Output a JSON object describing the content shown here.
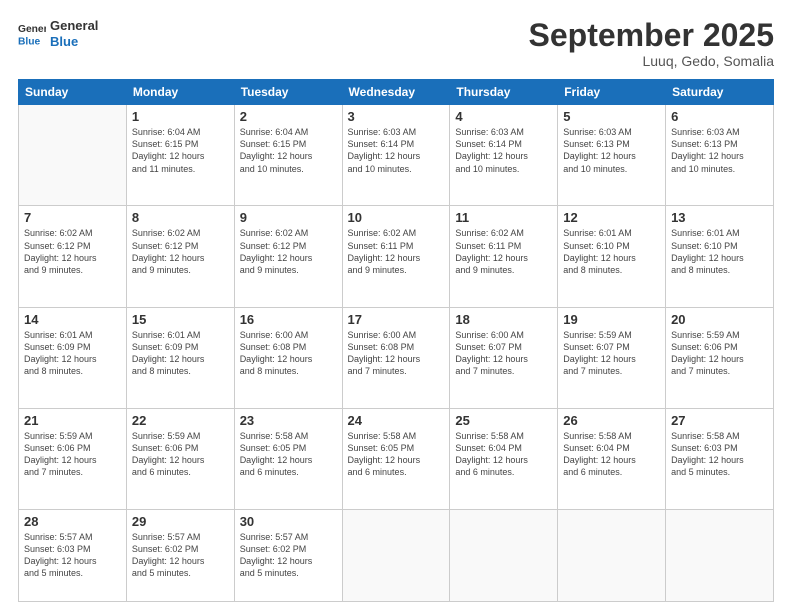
{
  "header": {
    "logo_line1": "General",
    "logo_line2": "Blue",
    "month": "September 2025",
    "location": "Luuq, Gedo, Somalia"
  },
  "weekdays": [
    "Sunday",
    "Monday",
    "Tuesday",
    "Wednesday",
    "Thursday",
    "Friday",
    "Saturday"
  ],
  "weeks": [
    [
      {
        "day": "",
        "info": ""
      },
      {
        "day": "1",
        "info": "Sunrise: 6:04 AM\nSunset: 6:15 PM\nDaylight: 12 hours\nand 11 minutes."
      },
      {
        "day": "2",
        "info": "Sunrise: 6:04 AM\nSunset: 6:15 PM\nDaylight: 12 hours\nand 10 minutes."
      },
      {
        "day": "3",
        "info": "Sunrise: 6:03 AM\nSunset: 6:14 PM\nDaylight: 12 hours\nand 10 minutes."
      },
      {
        "day": "4",
        "info": "Sunrise: 6:03 AM\nSunset: 6:14 PM\nDaylight: 12 hours\nand 10 minutes."
      },
      {
        "day": "5",
        "info": "Sunrise: 6:03 AM\nSunset: 6:13 PM\nDaylight: 12 hours\nand 10 minutes."
      },
      {
        "day": "6",
        "info": "Sunrise: 6:03 AM\nSunset: 6:13 PM\nDaylight: 12 hours\nand 10 minutes."
      }
    ],
    [
      {
        "day": "7",
        "info": "Sunrise: 6:02 AM\nSunset: 6:12 PM\nDaylight: 12 hours\nand 9 minutes."
      },
      {
        "day": "8",
        "info": "Sunrise: 6:02 AM\nSunset: 6:12 PM\nDaylight: 12 hours\nand 9 minutes."
      },
      {
        "day": "9",
        "info": "Sunrise: 6:02 AM\nSunset: 6:12 PM\nDaylight: 12 hours\nand 9 minutes."
      },
      {
        "day": "10",
        "info": "Sunrise: 6:02 AM\nSunset: 6:11 PM\nDaylight: 12 hours\nand 9 minutes."
      },
      {
        "day": "11",
        "info": "Sunrise: 6:02 AM\nSunset: 6:11 PM\nDaylight: 12 hours\nand 9 minutes."
      },
      {
        "day": "12",
        "info": "Sunrise: 6:01 AM\nSunset: 6:10 PM\nDaylight: 12 hours\nand 8 minutes."
      },
      {
        "day": "13",
        "info": "Sunrise: 6:01 AM\nSunset: 6:10 PM\nDaylight: 12 hours\nand 8 minutes."
      }
    ],
    [
      {
        "day": "14",
        "info": "Sunrise: 6:01 AM\nSunset: 6:09 PM\nDaylight: 12 hours\nand 8 minutes."
      },
      {
        "day": "15",
        "info": "Sunrise: 6:01 AM\nSunset: 6:09 PM\nDaylight: 12 hours\nand 8 minutes."
      },
      {
        "day": "16",
        "info": "Sunrise: 6:00 AM\nSunset: 6:08 PM\nDaylight: 12 hours\nand 8 minutes."
      },
      {
        "day": "17",
        "info": "Sunrise: 6:00 AM\nSunset: 6:08 PM\nDaylight: 12 hours\nand 7 minutes."
      },
      {
        "day": "18",
        "info": "Sunrise: 6:00 AM\nSunset: 6:07 PM\nDaylight: 12 hours\nand 7 minutes."
      },
      {
        "day": "19",
        "info": "Sunrise: 5:59 AM\nSunset: 6:07 PM\nDaylight: 12 hours\nand 7 minutes."
      },
      {
        "day": "20",
        "info": "Sunrise: 5:59 AM\nSunset: 6:06 PM\nDaylight: 12 hours\nand 7 minutes."
      }
    ],
    [
      {
        "day": "21",
        "info": "Sunrise: 5:59 AM\nSunset: 6:06 PM\nDaylight: 12 hours\nand 7 minutes."
      },
      {
        "day": "22",
        "info": "Sunrise: 5:59 AM\nSunset: 6:06 PM\nDaylight: 12 hours\nand 6 minutes."
      },
      {
        "day": "23",
        "info": "Sunrise: 5:58 AM\nSunset: 6:05 PM\nDaylight: 12 hours\nand 6 minutes."
      },
      {
        "day": "24",
        "info": "Sunrise: 5:58 AM\nSunset: 6:05 PM\nDaylight: 12 hours\nand 6 minutes."
      },
      {
        "day": "25",
        "info": "Sunrise: 5:58 AM\nSunset: 6:04 PM\nDaylight: 12 hours\nand 6 minutes."
      },
      {
        "day": "26",
        "info": "Sunrise: 5:58 AM\nSunset: 6:04 PM\nDaylight: 12 hours\nand 6 minutes."
      },
      {
        "day": "27",
        "info": "Sunrise: 5:58 AM\nSunset: 6:03 PM\nDaylight: 12 hours\nand 5 minutes."
      }
    ],
    [
      {
        "day": "28",
        "info": "Sunrise: 5:57 AM\nSunset: 6:03 PM\nDaylight: 12 hours\nand 5 minutes."
      },
      {
        "day": "29",
        "info": "Sunrise: 5:57 AM\nSunset: 6:02 PM\nDaylight: 12 hours\nand 5 minutes."
      },
      {
        "day": "30",
        "info": "Sunrise: 5:57 AM\nSunset: 6:02 PM\nDaylight: 12 hours\nand 5 minutes."
      },
      {
        "day": "",
        "info": ""
      },
      {
        "day": "",
        "info": ""
      },
      {
        "day": "",
        "info": ""
      },
      {
        "day": "",
        "info": ""
      }
    ]
  ]
}
